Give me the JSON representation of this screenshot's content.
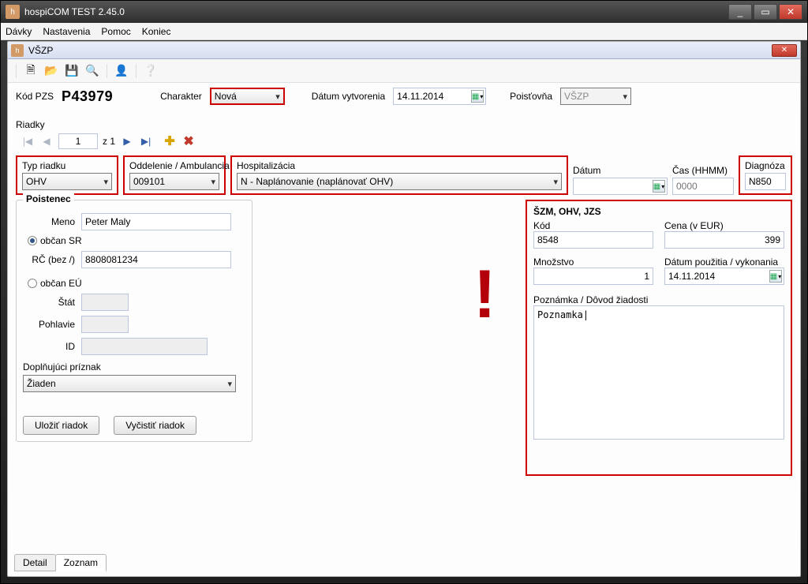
{
  "window": {
    "title": "hospiCOM TEST 2.45.0",
    "minimize": "_",
    "maximize": "▭",
    "close": "✕"
  },
  "menubar": [
    "Dávky",
    "Nastavenia",
    "Pomoc",
    "Koniec"
  ],
  "child": {
    "title": "VŠZP",
    "close": "✕"
  },
  "toolbar_icons": {
    "new": "🗎",
    "open": "📂",
    "save": "💾",
    "search": "🔍",
    "send": "👤",
    "help": "❔"
  },
  "info": {
    "kod_pzs_label": "Kód PZS",
    "kod_pzs_value": "P43979",
    "charakter_label": "Charakter",
    "charakter_value": "Nová",
    "datum_vytvorenia_label": "Dátum vytvorenia",
    "datum_vytvorenia_value": "14.11.2014",
    "poistovna_label": "Poisťovňa",
    "poistovna_value": "VŠZP"
  },
  "riadky": {
    "label": "Riadky",
    "page_current": "1",
    "page_prefix": "z",
    "page_total": "1"
  },
  "fields": {
    "typ_riadku": {
      "label": "Typ riadku",
      "value": "OHV"
    },
    "oddelenie": {
      "label": "Oddelenie / Ambulancia",
      "value": "009101"
    },
    "hospitalizacia": {
      "label": "Hospitalizácia",
      "value": "N - Naplánovanie (naplánovať OHV)"
    },
    "datum": {
      "label": "Dátum",
      "value": ""
    },
    "cas": {
      "label": "Čas (HHMM)",
      "placeholder": "0000",
      "value": ""
    },
    "diagnoza": {
      "label": "Diagnóza",
      "value": "N850"
    }
  },
  "poistenec": {
    "legend": "Poistenec",
    "meno_label": "Meno",
    "meno_value": "Peter Maly",
    "obcan_sr_label": "občan SR",
    "rc_label": "RČ (bez /)",
    "rc_value": "8808081234",
    "obcan_eu_label": "občan EÚ",
    "stat_label": "Štát",
    "pohlavie_label": "Pohlavie",
    "id_label": "ID",
    "doplnujuci_label": "Doplňujúci príznak",
    "doplnujuci_value": "Žiaden",
    "ulozit": "Uložiť riadok",
    "vycistit": "Vyčistiť riadok"
  },
  "szm": {
    "title": "ŠZM, OHV, JZS",
    "kod_label": "Kód",
    "kod_value": "8548",
    "cena_label": "Cena (v EUR)",
    "cena_value": "399",
    "mnozstvo_label": "Množstvo",
    "mnozstvo_value": "1",
    "datum_pouzitia_label": "Dátum použitia / vykonania",
    "datum_pouzitia_value": "14.11.2014",
    "poznamka_label": "Poznámka / Dôvod žiadosti",
    "poznamka_value": "Poznamka|"
  },
  "tabs": {
    "detail": "Detail",
    "zoznam": "Zoznam"
  },
  "exclaim": "!"
}
